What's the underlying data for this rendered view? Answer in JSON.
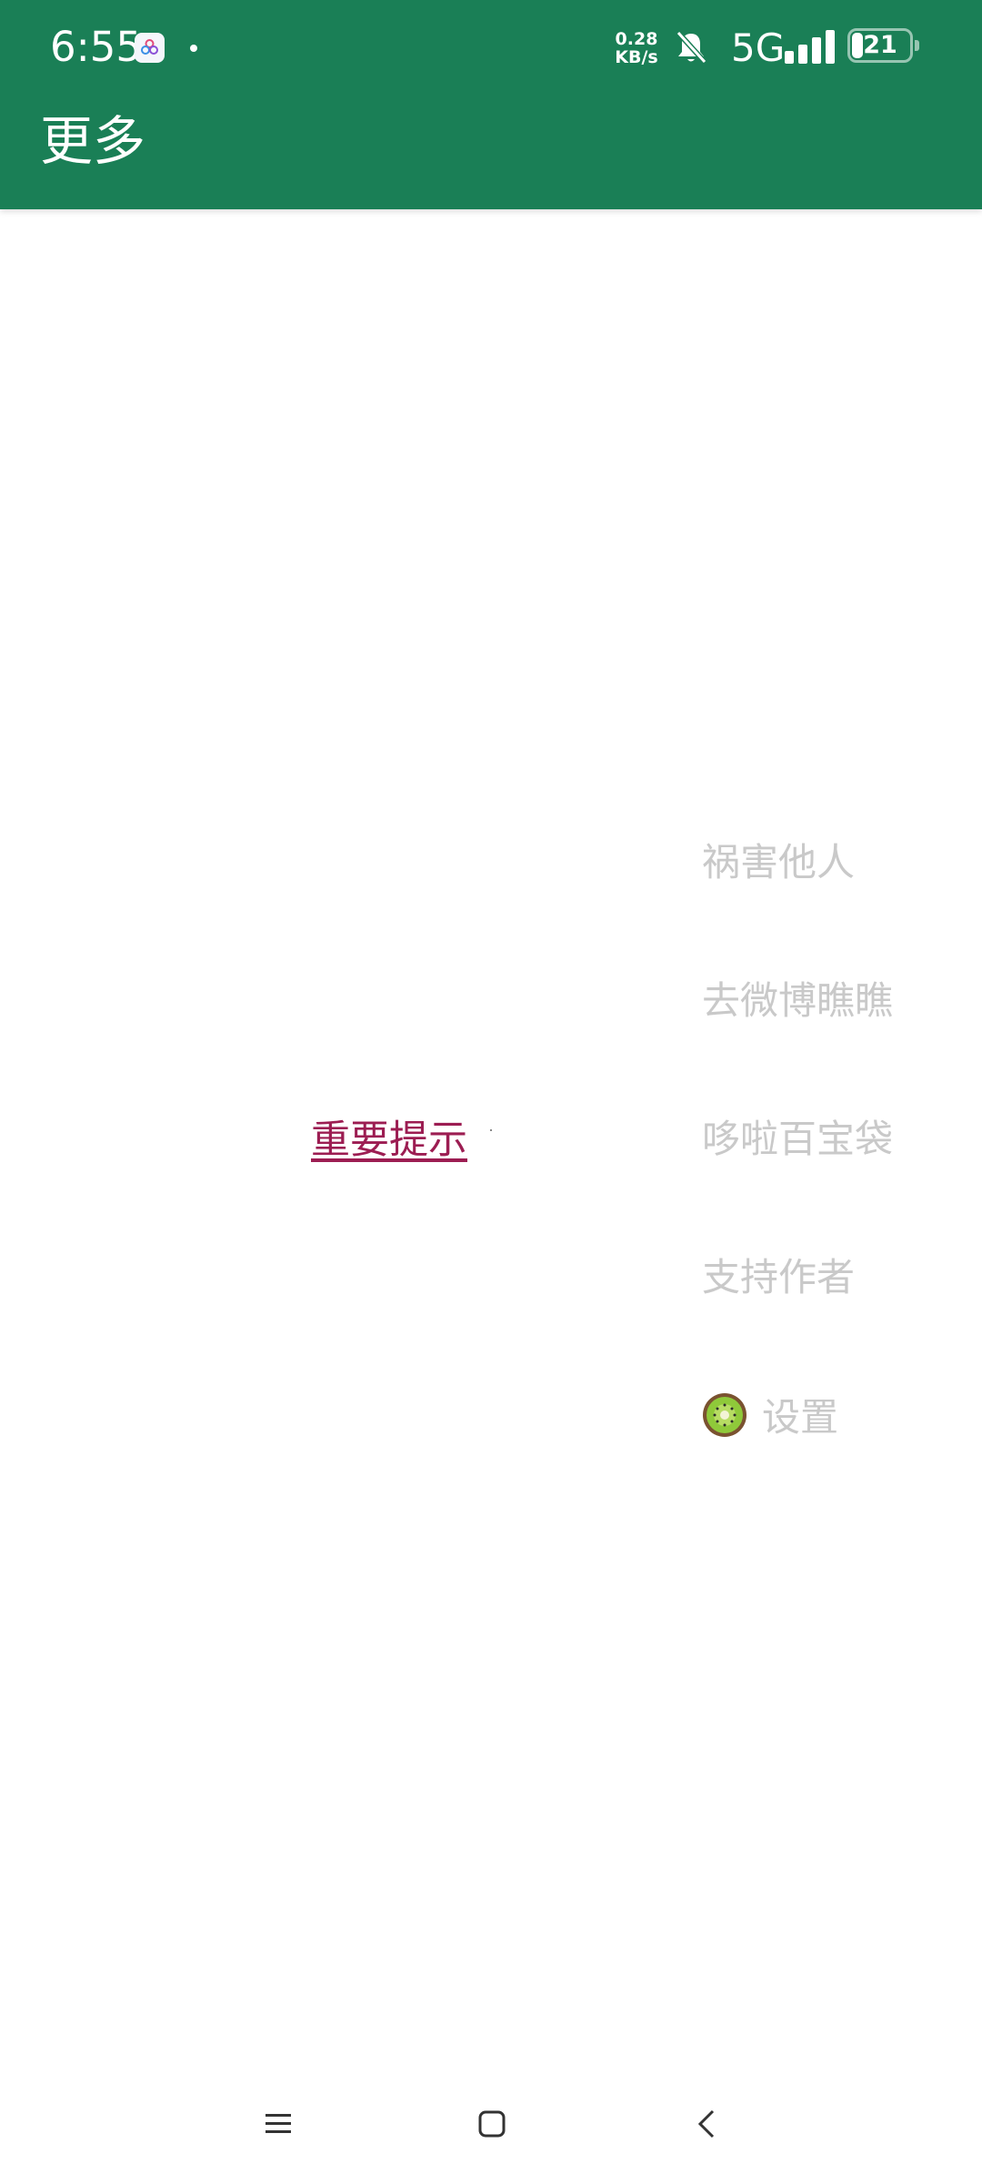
{
  "status_bar": {
    "time": "6:55",
    "net_speed_value": "0.28",
    "net_speed_unit": "KB/s",
    "network": "5G",
    "battery": "21"
  },
  "header": {
    "title": "更多"
  },
  "main": {
    "notice_link": "重要提示"
  },
  "menu": {
    "items": [
      {
        "label": "祸害他人"
      },
      {
        "label": "去微博瞧瞧"
      },
      {
        "label": "哆啦百宝袋"
      },
      {
        "label": "支持作者"
      },
      {
        "label": "设置",
        "icon": "kiwi-icon"
      }
    ]
  },
  "nav_bar": {
    "icons": [
      "menu-icon",
      "home-icon",
      "back-icon"
    ]
  },
  "colors": {
    "header": "#1a7f56",
    "link": "#9c1d52",
    "menu_text": "#c9c9c9"
  }
}
